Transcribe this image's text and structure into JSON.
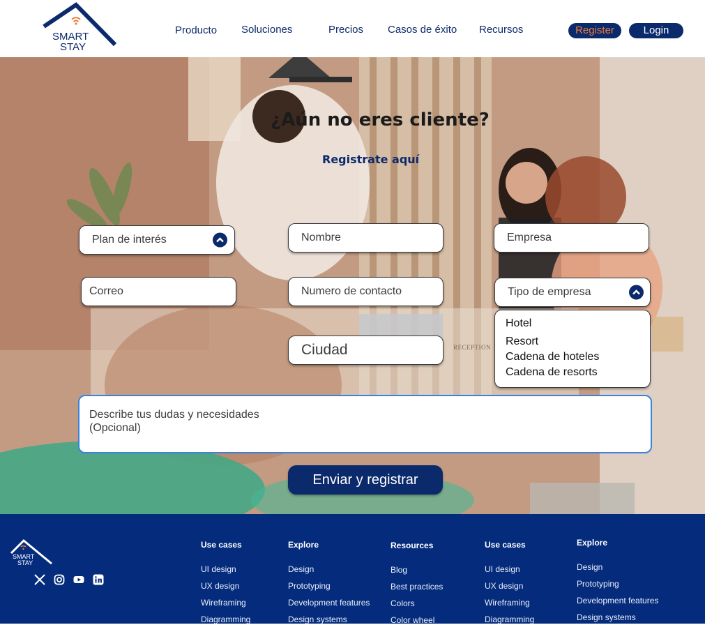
{
  "brand": {
    "line1": "SMART",
    "line2": "STAY"
  },
  "nav": [
    "Producto",
    "Soluciones",
    "Precios",
    "Casos de éxito",
    "Recursos"
  ],
  "auth": {
    "register": "Register",
    "login": "Login"
  },
  "hero": {
    "title": "¿Aún no eres cliente?",
    "subtitle": "Registrate aquí",
    "reception_sign": "RECEPTION"
  },
  "form": {
    "plan": "Plan de interés",
    "nombre": "Nombre",
    "empresa": "Empresa",
    "correo": "Correo",
    "contacto": "Numero de contacto",
    "tipo": "Tipo de empresa",
    "tipo_options": [
      "Hotel",
      "Resort",
      "Cadena de hoteles",
      "Cadena de resorts"
    ],
    "ciudad": "Ciudad",
    "dudas_line1": "Describe tus dudas y necesidades",
    "dudas_line2": "(Opcional)",
    "submit": "Enviar y registrar"
  },
  "footer": {
    "columns": [
      {
        "title": "Use cases",
        "links": [
          "UI design",
          "UX design",
          "Wireframing",
          "Diagramming"
        ]
      },
      {
        "title": "Explore",
        "links": [
          "Design",
          "Prototyping",
          "Development features",
          "Design systems"
        ]
      },
      {
        "title": "Resources",
        "links": [
          "Blog",
          "Best practices",
          "Colors",
          "Color wheel"
        ]
      },
      {
        "title": "Use cases",
        "links": [
          "UI design",
          "UX design",
          "Wireframing",
          "Diagramming"
        ]
      },
      {
        "title": "Explore",
        "links": [
          "Design",
          "Prototyping",
          "Development features",
          "Design systems"
        ]
      }
    ],
    "social": [
      "x-icon",
      "instagram-icon",
      "youtube-icon",
      "linkedin-icon"
    ]
  },
  "colors": {
    "navy": "#0b2a6b",
    "footer": "#052c7c",
    "accent": "#f07d3c"
  }
}
